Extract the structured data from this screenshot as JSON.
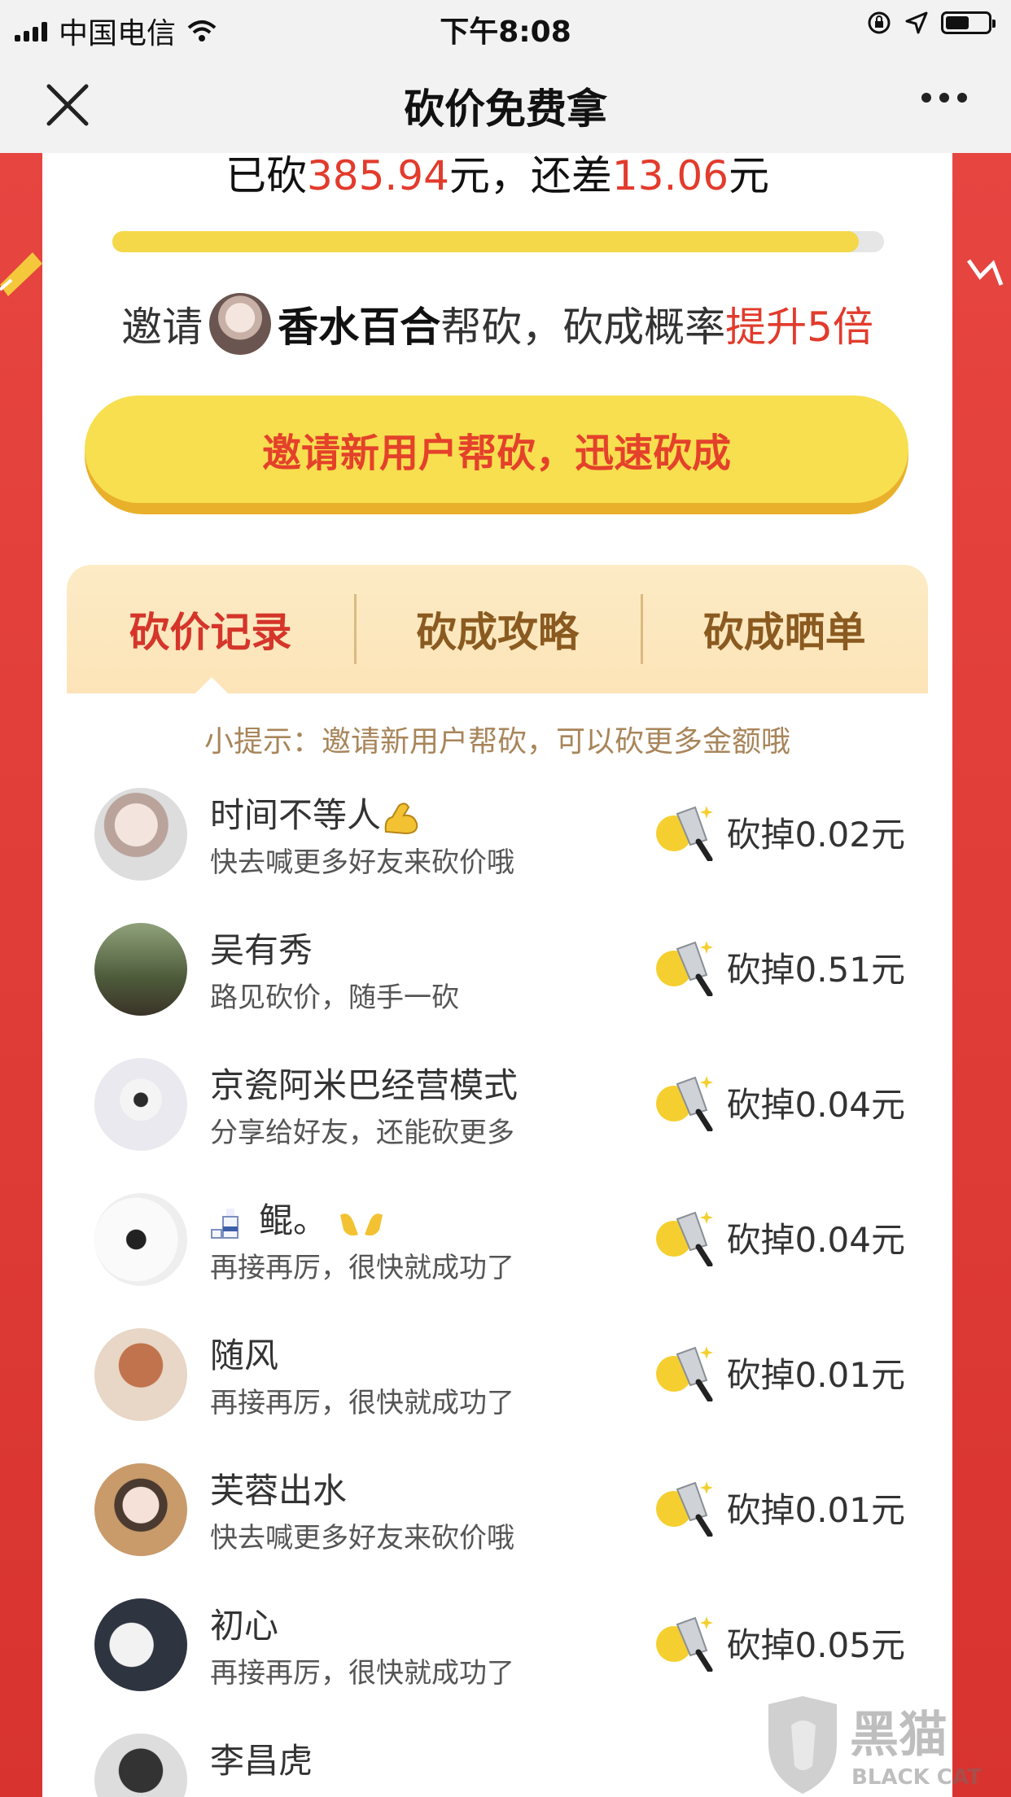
{
  "status_bar": {
    "carrier": "中国电信",
    "time": "下午8:08"
  },
  "nav": {
    "title": "砍价免费拿"
  },
  "progress": {
    "prefix": "已砍",
    "cut_amount": "385.94",
    "mid": "元，还差",
    "remaining": "13.06",
    "suffix": "元",
    "fraction": 0.967
  },
  "invite": {
    "prefix": "邀请",
    "name": "香水百合",
    "mid": "帮砍，砍成概率",
    "boost": "提升5倍"
  },
  "cta": {
    "label": "邀请新用户帮砍，迅速砍成"
  },
  "tabs": [
    {
      "label": "砍价记录"
    },
    {
      "label": "砍成攻略"
    },
    {
      "label": "砍成晒单"
    }
  ],
  "tip": "小提示：邀请新用户帮砍，可以砍更多金额哦",
  "records": [
    {
      "name": "时间不等人",
      "sub": "快去喊更多好友来砍价哦",
      "cut": "砍掉0.02元"
    },
    {
      "name": "吴有秀",
      "sub": "路见砍价，随手一砍",
      "cut": "砍掉0.51元"
    },
    {
      "name": "京瓷阿米巴经营模式",
      "sub": "分享给好友，还能砍更多",
      "cut": "砍掉0.04元"
    },
    {
      "name": "鲲。",
      "sub": "再接再厉，很快就成功了",
      "cut": "砍掉0.04元"
    },
    {
      "name": "随风",
      "sub": "再接再厉，很快就成功了",
      "cut": "砍掉0.01元"
    },
    {
      "name": "芙蓉出水",
      "sub": "快去喊更多好友来砍价哦",
      "cut": "砍掉0.01元"
    },
    {
      "name": "初心",
      "sub": "再接再厉，很快就成功了",
      "cut": "砍掉0.05元"
    },
    {
      "name": "李昌虎",
      "sub": "",
      "cut": ""
    }
  ],
  "watermark": {
    "cn": "黑猫",
    "en": "BLACK CAT"
  },
  "colors": {
    "accent_red": "#e23b2c",
    "button_yellow": "#f7df4f",
    "tab_bg": "#fcebc5",
    "page_red": "#e43a35"
  }
}
